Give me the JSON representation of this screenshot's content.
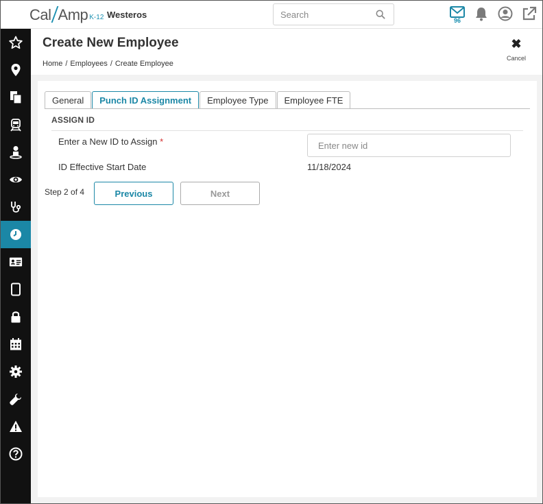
{
  "header": {
    "logo_main": "Cal",
    "logo_second": "Amp",
    "logo_suffix": "K-12",
    "tenant": "Westeros",
    "search_placeholder": "Search",
    "mail_count": "96",
    "accent_color": "#1b87a6"
  },
  "sidebar": {
    "items": [
      {
        "icon": "star-icon",
        "active": false
      },
      {
        "icon": "map-pin-icon",
        "active": false
      },
      {
        "icon": "documents-icon",
        "active": false
      },
      {
        "icon": "train-icon",
        "active": false
      },
      {
        "icon": "person-icon",
        "active": false
      },
      {
        "icon": "eye-icon",
        "active": false
      },
      {
        "icon": "stethoscope-icon",
        "active": false
      },
      {
        "icon": "clock-icon",
        "active": true
      },
      {
        "icon": "id-card-icon",
        "active": false
      },
      {
        "icon": "tablet-icon",
        "active": false
      },
      {
        "icon": "lock-icon",
        "active": false
      },
      {
        "icon": "calendar-icon",
        "active": false
      },
      {
        "icon": "gear-icon",
        "active": false
      },
      {
        "icon": "wrench-icon",
        "active": false
      },
      {
        "icon": "warning-icon",
        "active": false
      },
      {
        "icon": "help-icon",
        "active": false
      }
    ]
  },
  "page": {
    "title": "Create New Employee",
    "breadcrumb": [
      "Home",
      "/",
      "Employees",
      "/",
      "Create Employee"
    ],
    "cancel_label": "Cancel"
  },
  "tabs": [
    {
      "label": "General",
      "active": false
    },
    {
      "label": "Punch ID Assignment",
      "active": true
    },
    {
      "label": "Employee Type",
      "active": false
    },
    {
      "label": "Employee FTE",
      "active": false
    }
  ],
  "form": {
    "section_title": "ASSIGN ID",
    "new_id_label": "Enter a New ID to Assign",
    "required_marker": "*",
    "new_id_placeholder": "Enter new id",
    "new_id_value": "",
    "start_date_label": "ID Effective Start Date",
    "start_date_value": "11/18/2024"
  },
  "wizard": {
    "step_text": "Step 2 of 4",
    "previous_label": "Previous",
    "next_label": "Next",
    "next_disabled": true
  }
}
